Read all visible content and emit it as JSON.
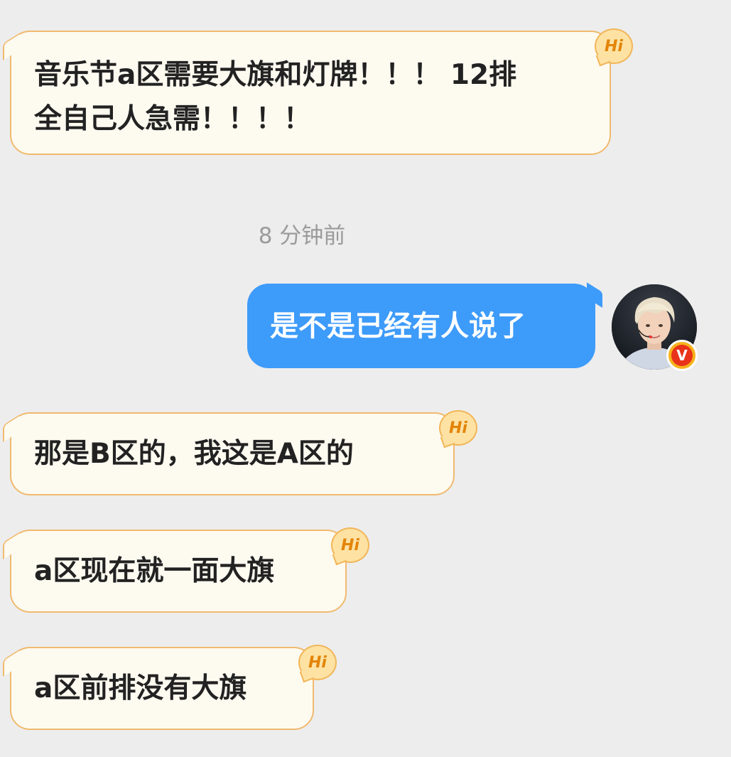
{
  "messages": [
    {
      "direction": "incoming",
      "lines": [
        "音乐节a区需要大旗和灯牌！！！ 12排",
        "全自己人急需！！！！"
      ],
      "badge": "Hi"
    },
    {
      "direction": "timestamp",
      "text": "8 分钟前"
    },
    {
      "direction": "outgoing",
      "text": "是不是已经有人说了",
      "verified_badge": "V"
    },
    {
      "direction": "incoming",
      "text": "那是B区的，我这是A区的",
      "badge": "Hi"
    },
    {
      "direction": "incoming",
      "text": "a区现在就一面大旗",
      "badge": "Hi"
    },
    {
      "direction": "incoming",
      "text": "a区前排没有大旗",
      "badge": "Hi"
    }
  ],
  "colors": {
    "background": "#ededed",
    "incoming_bubble": "#fdfaf0",
    "incoming_border": "#f0ba6f",
    "outgoing_bubble": "#3d9bfa",
    "hi_badge": "#fde2a3",
    "hi_text": "#e38408",
    "timestamp_text": "#9b9b9b"
  },
  "icons": {
    "hi_badge": "hi-badge-icon",
    "verified": "verified-v-badge-icon",
    "avatar": "user-avatar"
  }
}
